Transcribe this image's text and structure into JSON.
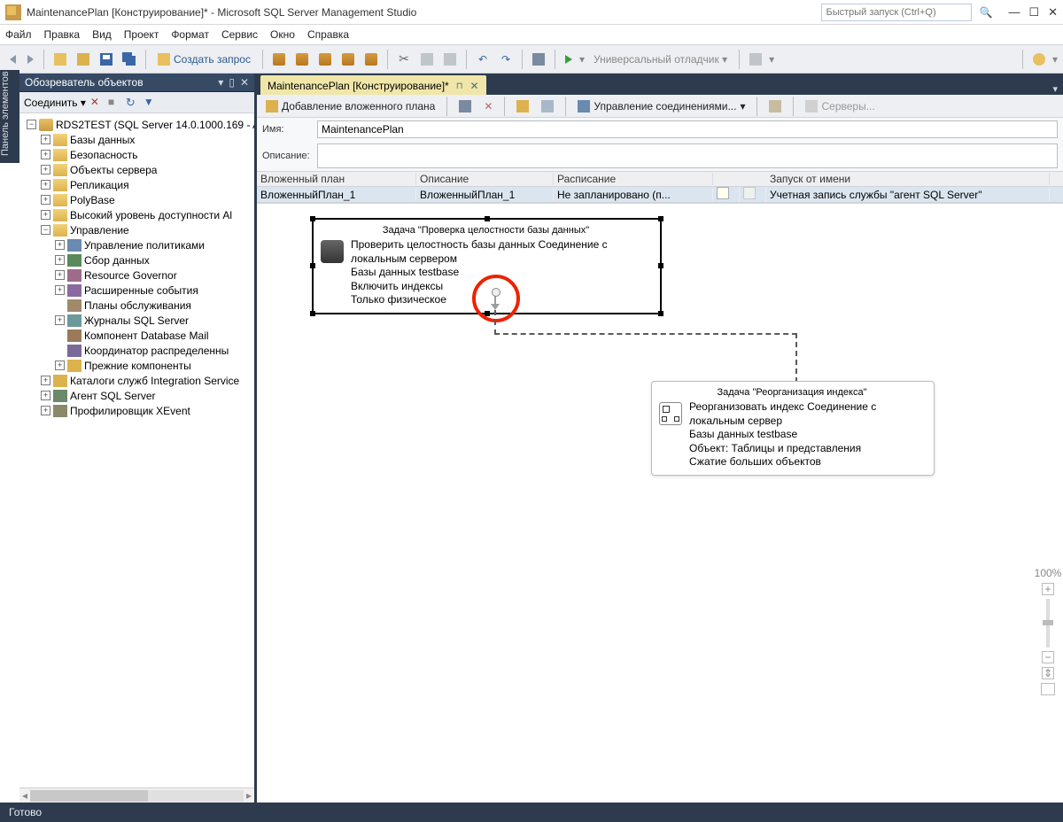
{
  "title": "MaintenancePlan [Конструирование]* - Microsoft SQL Server Management Studio",
  "quicklaunch_placeholder": "Быстрый запуск (Ctrl+Q)",
  "menu": [
    "Файл",
    "Правка",
    "Вид",
    "Проект",
    "Формат",
    "Сервис",
    "Окно",
    "Справка"
  ],
  "toolbar": {
    "new_query": "Создать запрос",
    "debugger": "Универсальный отладчик"
  },
  "vert_label": "Панель элементов",
  "object_explorer": {
    "title": "Обозреватель объектов",
    "connect": "Соединить",
    "root": "RDS2TEST (SQL Server 14.0.1000.169 - A",
    "nodes": {
      "databases": "Базы данных",
      "security": "Безопасность",
      "server_objects": "Объекты сервера",
      "replication": "Репликация",
      "polybase": "PolyBase",
      "high_avail": "Высокий уровень доступности Al",
      "management": "Управление",
      "policy": "Управление политиками",
      "datacoll": "Сбор данных",
      "rg": "Resource Governor",
      "xe": "Расширенные события",
      "mp": "Планы обслуживания",
      "logs": "Журналы SQL Server",
      "dbmail": "Компонент Database Mail",
      "dtc": "Координатор распределенны",
      "legacy": "Прежние компоненты",
      "ssisdb": "Каталоги служб Integration Service",
      "agent": "Агент SQL Server",
      "profiler": "Профилировщик XEvent"
    }
  },
  "doc_tab": "MaintenancePlan [Конструирование]*",
  "design_tb": {
    "add_subplan": "Добавление вложенного плана",
    "manage_conn": "Управление соединениями...",
    "servers": "Серверы..."
  },
  "form": {
    "name_lbl": "Имя:",
    "name_val": "MaintenancePlan",
    "desc_lbl": "Описание:",
    "desc_val": ""
  },
  "grid": {
    "col_subplan": "Вложенный план",
    "col_desc": "Описание",
    "col_schedule": "Расписание",
    "col_runas": "Запуск от имени",
    "row": {
      "subplan": "ВложенныйПлан_1",
      "desc": "ВложенныйПлан_1",
      "schedule": "Не запланировано (п...",
      "runas": "Учетная запись службы \"агент SQL Server\""
    }
  },
  "task1": {
    "title": "Задача \"Проверка целостности базы данных\"",
    "l1": "Проверить целостность базы данных Соединение с локальным сервером",
    "l2": "Базы данных testbase",
    "l3": "Включить индексы",
    "l4": "Только физическое"
  },
  "task2": {
    "title": "Задача \"Реорганизация индекса\"",
    "l1": "Реорганизовать индекс Соединение с локальным сервер",
    "l2": "Базы данных testbase",
    "l3": "Объект: Таблицы и представления",
    "l4": "Сжатие больших объектов"
  },
  "zoom_pct": "100%",
  "status": "Готово"
}
